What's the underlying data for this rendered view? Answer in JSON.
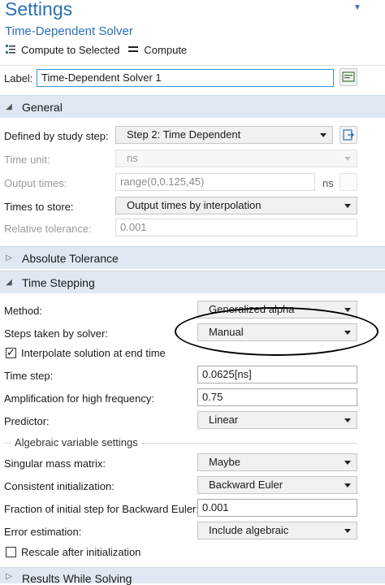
{
  "header": {
    "title": "Settings",
    "subtitle": "Time-Dependent Solver",
    "compute_selected_label": "Compute to Selected",
    "compute_label": "Compute"
  },
  "label_row": {
    "label": "Label:",
    "value": "Time-Dependent Solver 1"
  },
  "sections": {
    "general": "General",
    "absolute_tolerance": "Absolute Tolerance",
    "time_stepping": "Time Stepping",
    "results_while_solving": "Results While Solving"
  },
  "general": {
    "study_step_label": "Defined by study step:",
    "study_step_value": "Step 2: Time Dependent",
    "time_unit_label": "Time unit:",
    "time_unit_value": "ns",
    "output_times_label": "Output times:",
    "output_times_value": "range(0,0.125,45)",
    "output_times_unit": "ns",
    "times_to_store_label": "Times to store:",
    "times_to_store_value": "Output times by interpolation",
    "rel_tol_label": "Relative tolerance:",
    "rel_tol_value": "0.001"
  },
  "time_stepping": {
    "method_label": "Method:",
    "method_value": "Generalized alpha",
    "steps_label": "Steps taken by solver:",
    "steps_value": "Manual",
    "interpolate_label": "Interpolate solution at end time",
    "interpolate_checked": true,
    "time_step_label": "Time step:",
    "time_step_value": "0.0625[ns]",
    "amplification_label": "Amplification for high frequency:",
    "amplification_value": "0.75",
    "predictor_label": "Predictor:",
    "predictor_value": "Linear",
    "algebraic_group_label": "Algebraic variable settings",
    "singular_label": "Singular mass matrix:",
    "singular_value": "Maybe",
    "consistent_label": "Consistent initialization:",
    "consistent_value": "Backward Euler",
    "fraction_label": "Fraction of initial step for Backward Euler:",
    "fraction_value": "0.001",
    "error_label": "Error estimation:",
    "error_value": "Include algebraic",
    "rescale_label": "Rescale after initialization",
    "rescale_checked": false
  },
  "colors": {
    "accent": "#2b6fb5",
    "section_bg": "#dfe8f2",
    "focus_border": "#3a8edb"
  }
}
